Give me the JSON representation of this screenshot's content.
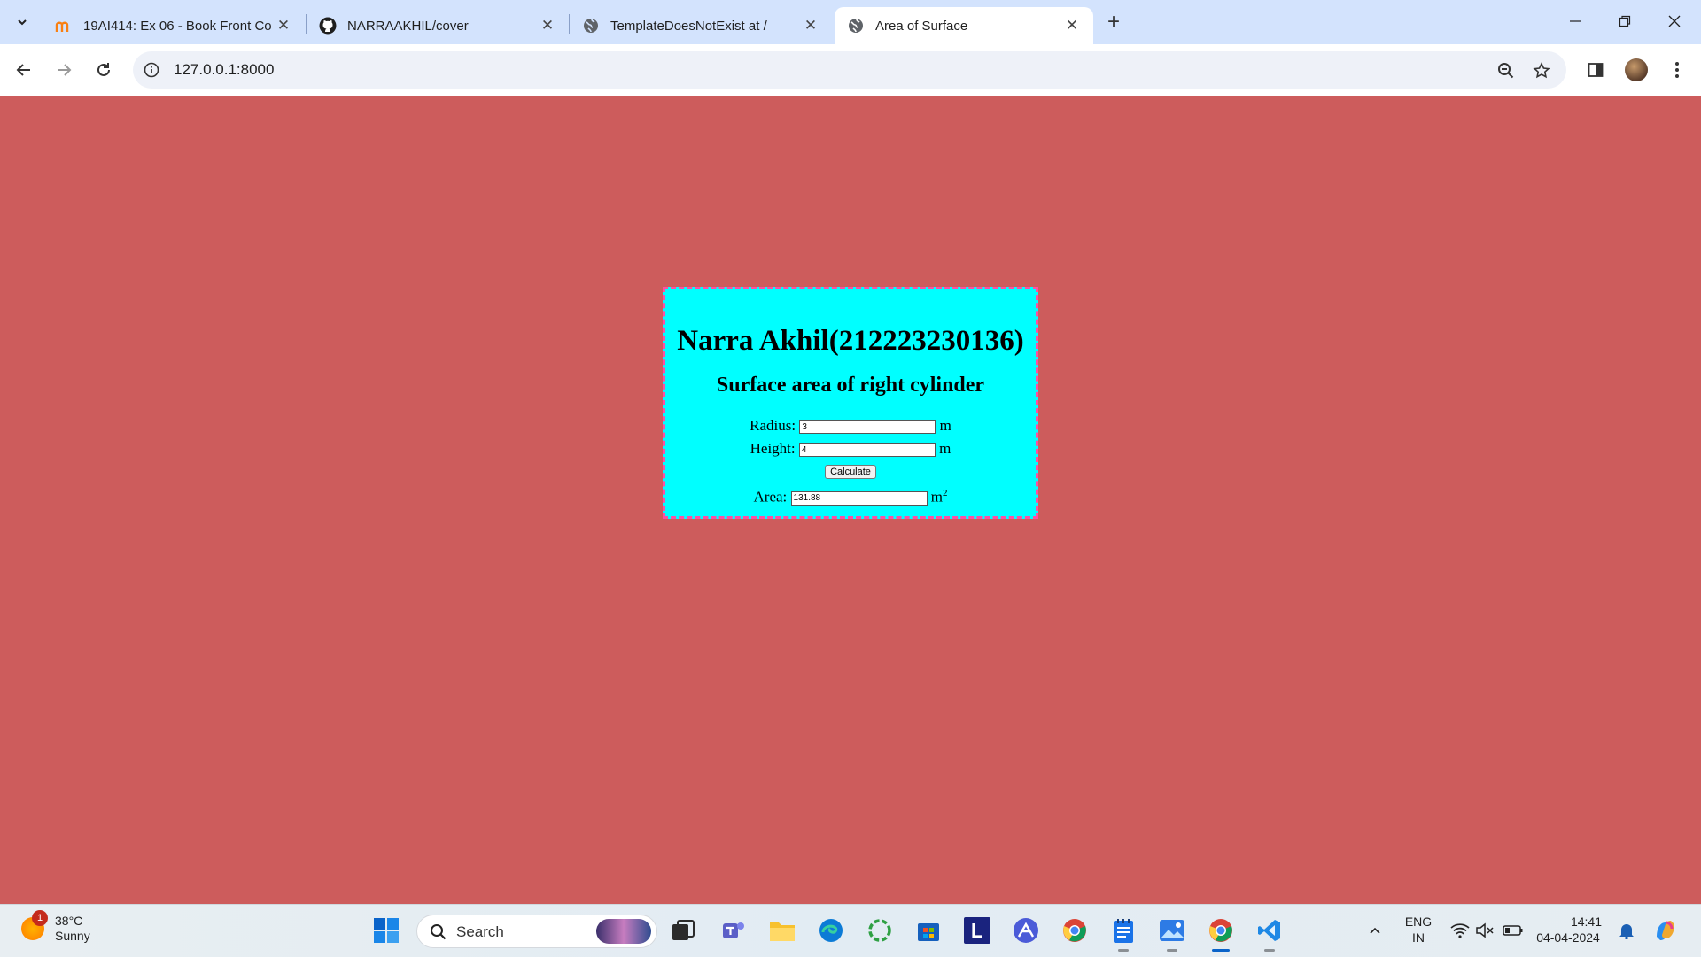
{
  "browser": {
    "tabs": [
      {
        "title": "19AI414: Ex 06 - Book Front Co",
        "favicon": "moodle-icon",
        "active": false
      },
      {
        "title": "NARRAAKHIL/cover",
        "favicon": "github-icon",
        "active": false
      },
      {
        "title": "TemplateDoesNotExist at /",
        "favicon": "globe-icon",
        "active": false
      },
      {
        "title": "Area of Surface",
        "favicon": "globe-icon",
        "active": true
      }
    ],
    "url": "127.0.0.1:8000"
  },
  "page": {
    "heading": "Narra Akhil(212223230136)",
    "subheading": "Surface area of right cylinder",
    "radius_label": "Radius:",
    "radius_value": "3",
    "radius_unit": "m",
    "height_label": "Height:",
    "height_value": "4",
    "height_unit": "m",
    "calculate_label": "Calculate",
    "area_label": "Area:",
    "area_value": "131.88",
    "area_unit": "m",
    "area_unit_sup": "2",
    "background_color": "#cd5c5c",
    "card_color": "#00ffff",
    "card_border_color": "#ff4fa3"
  },
  "taskbar": {
    "weather_temp": "38°C",
    "weather_desc": "Sunny",
    "weather_badge": "1",
    "search_label": "Search",
    "language_line1": "ENG",
    "language_line2": "IN",
    "time": "14:41",
    "date": "04-04-2024"
  }
}
